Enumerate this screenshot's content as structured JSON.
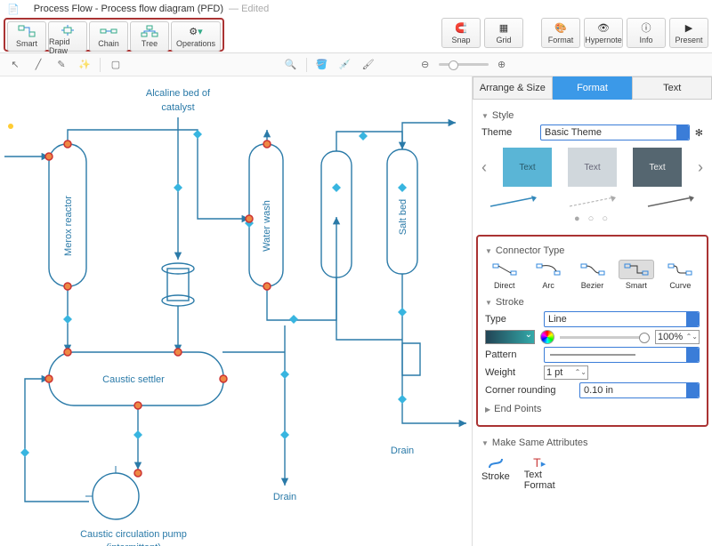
{
  "title": {
    "doc": "Process Flow - Process flow diagram (PFD)",
    "edited": "— Edited"
  },
  "toolbar": {
    "smart": "Smart",
    "rapid": "Rapid Draw",
    "chain": "Chain",
    "tree": "Tree",
    "ops": "Operations",
    "snap": "Snap",
    "grid": "Grid",
    "format": "Format",
    "hyper": "Hypernote",
    "info": "Info",
    "present": "Present"
  },
  "canvas": {
    "alcaline": "Alcaline bed of\ncatalyst",
    "merox": "Merox reactor",
    "water": "Water wash",
    "salt": "Salt bed",
    "caustic": "Caustic settler",
    "drain1": "Drain",
    "drain2": "Drain",
    "pump": "Caustic circulation pump\n(intermittent)"
  },
  "inspector": {
    "tabs": {
      "arrange": "Arrange & Size",
      "format": "Format",
      "text": "Text"
    },
    "style": "Style",
    "theme_l": "Theme",
    "theme_v": "Basic Theme",
    "sw": "Text",
    "connector": "Connector Type",
    "ct": {
      "direct": "Direct",
      "arc": "Arc",
      "bezier": "Bezier",
      "smart": "Smart",
      "curve": "Curve"
    },
    "stroke": "Stroke",
    "type_l": "Type",
    "type_v": "Line",
    "opacity": "100%",
    "pattern_l": "Pattern",
    "weight_l": "Weight",
    "weight_v": "1 pt",
    "corner_l": "Corner rounding",
    "corner_v": "0.10 in",
    "endpoints": "End Points",
    "msame": "Make Same Attributes",
    "ms": {
      "stroke": "Stroke",
      "tf": "Text\nFormat"
    }
  }
}
